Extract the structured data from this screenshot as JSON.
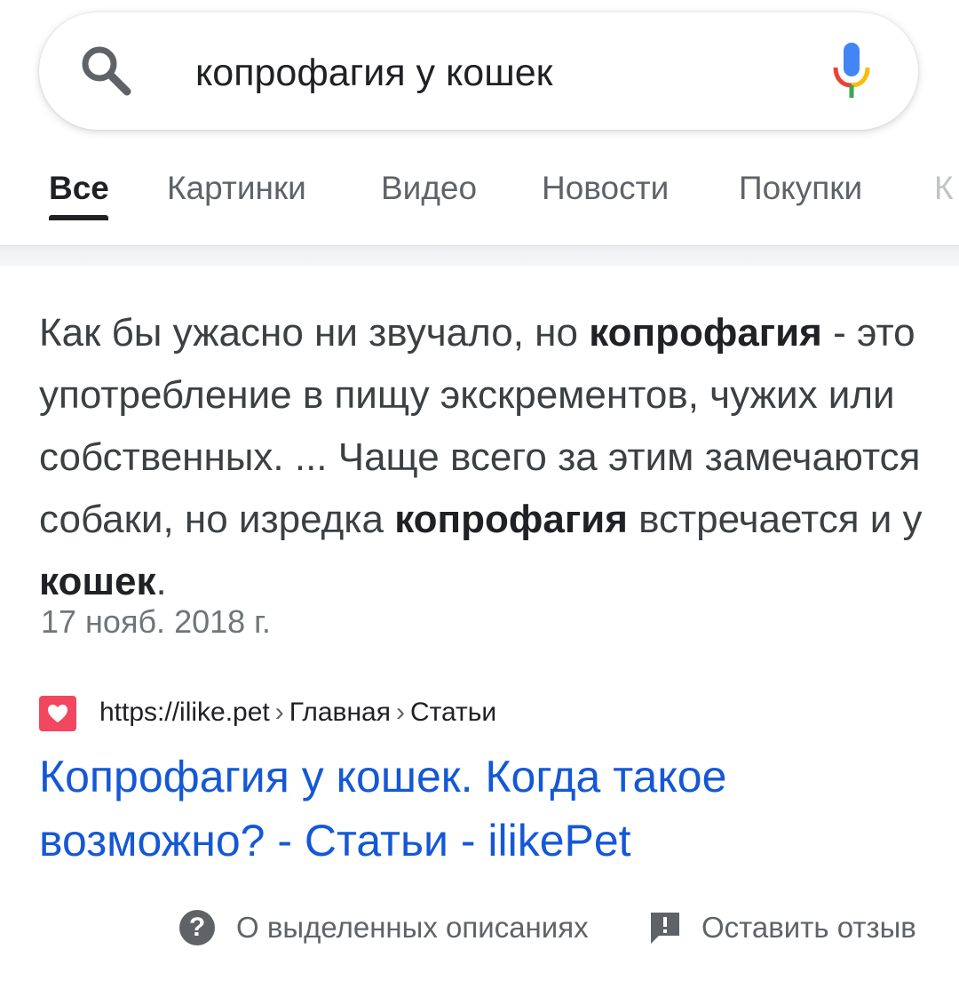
{
  "search": {
    "query": "копрофагия у кошек",
    "icon": "search-icon",
    "mic_icon": "microphone-icon"
  },
  "tabs": [
    {
      "label": "Все",
      "active": true
    },
    {
      "label": "Картинки",
      "active": false
    },
    {
      "label": "Видео",
      "active": false
    },
    {
      "label": "Новости",
      "active": false
    },
    {
      "label": "Покупки",
      "active": false
    },
    {
      "label": "К",
      "active": false
    }
  ],
  "featured_snippet": {
    "segments": [
      {
        "text": "Как бы ужасно ни звучало, но ",
        "bold": false
      },
      {
        "text": "копрофагия",
        "bold": true
      },
      {
        "text": " - это употребление в пищу экскрементов, чужих или собственных. ... Чаще всего за этим замечаются собаки, но изредка ",
        "bold": false
      },
      {
        "text": "копрофагия",
        "bold": true
      },
      {
        "text": " встречается и у ",
        "bold": false
      },
      {
        "text": "кошек",
        "bold": true
      },
      {
        "text": ".",
        "bold": false
      }
    ],
    "date": "17 нояб. 2018 г."
  },
  "result": {
    "favicon": "heart-icon",
    "favicon_color": "#f1475f",
    "breadcrumb": {
      "url": "https://ilike.pet",
      "sep": "›",
      "path_1": "Главная",
      "path_2": "Статьи"
    },
    "title": "Копрофагия у кошек. Когда такое возможно? - Статьи - ilikePet",
    "title_color": "#1558d6"
  },
  "footer": {
    "about_label": "О выделенных описаниях",
    "about_icon_glyph": "?",
    "feedback_label": "Оставить отзыв"
  }
}
